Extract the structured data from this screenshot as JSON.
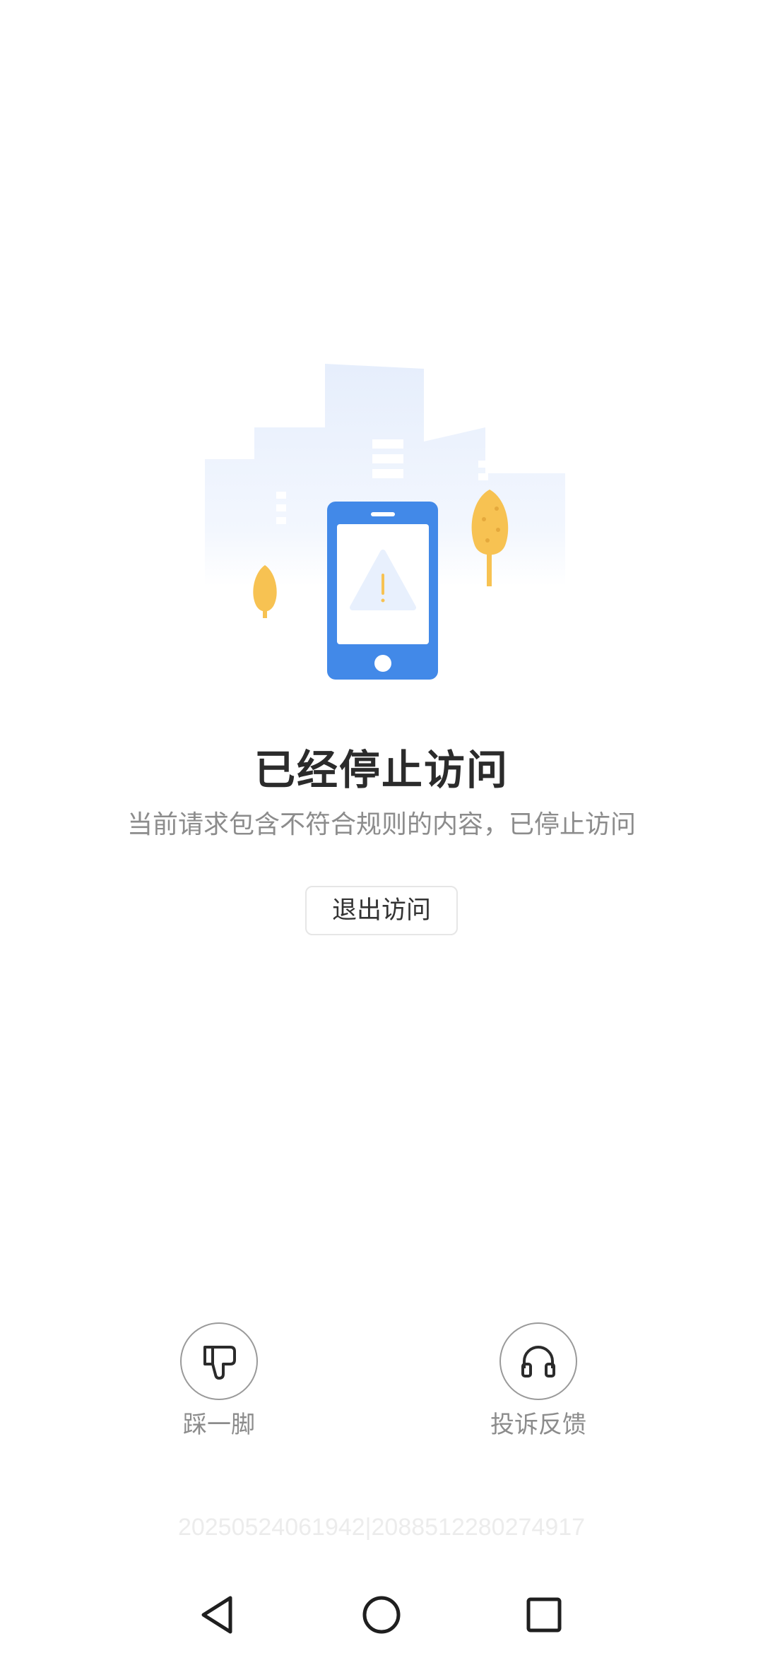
{
  "illustration": {
    "icon": "phone-warning-illustration",
    "colors": {
      "phone": "#4289e8",
      "tree": "#f7c252",
      "building": "#eaf1fd"
    }
  },
  "blocked": {
    "title": "已经停止访问",
    "message": "当前请求包含不符合规则的内容，已停止访问",
    "exit_label": "退出访问"
  },
  "actions": [
    {
      "label": "踩一脚",
      "icon": "thumbs-down-icon"
    },
    {
      "label": "投诉反馈",
      "icon": "headphones-icon"
    }
  ],
  "trace_id": "20250524061942|2088512280274917",
  "nav_bar": {
    "buttons": [
      "back-icon",
      "home-icon",
      "recents-icon"
    ]
  }
}
